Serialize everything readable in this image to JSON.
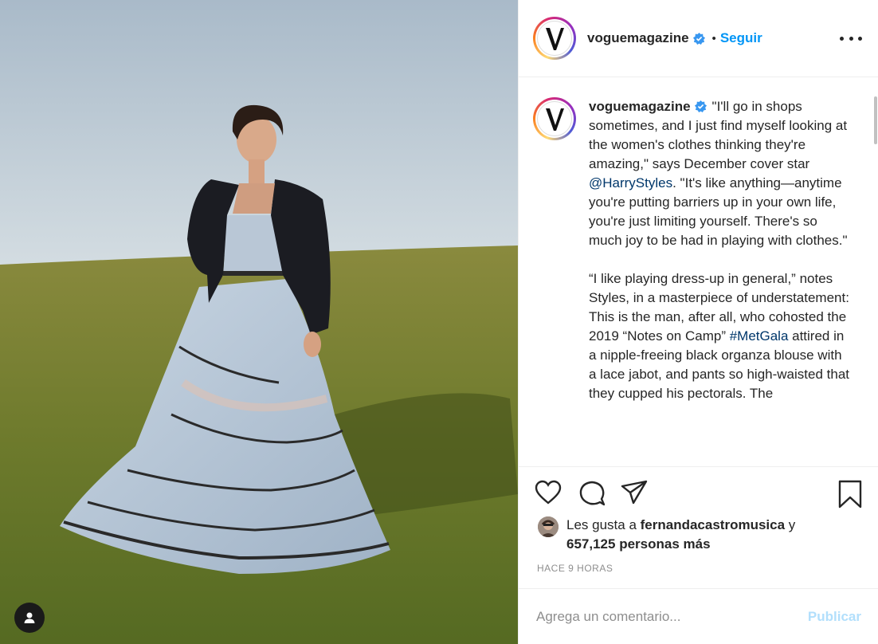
{
  "post": {
    "account": "voguemagazine",
    "follow_label": "Seguir",
    "separator": "•",
    "caption_paragraphs": [
      [
        {
          "type": "text",
          "value": "\"I'll go in shops sometimes, and I just find myself looking at the women's clothes thinking they're amazing,\" says December cover star "
        },
        {
          "type": "mention",
          "value": "@HarryStyles"
        },
        {
          "type": "text",
          "value": ". \"It's like anything—anytime you're putting barriers up in your own life, you're just limiting yourself. There's so much joy to be had in playing with clothes.\""
        }
      ],
      [
        {
          "type": "text",
          "value": "“I like playing dress-up in general,” notes Styles, in a masterpiece of understatement: This is the man, after all, who cohosted the 2019 “Notes on Camp” "
        },
        {
          "type": "mention",
          "value": "#MetGala"
        },
        {
          "type": "text",
          "value": " attired in a nipple-freeing black organza blouse with a lace jabot, and pants so high-waisted that they cupped his pectorals. The"
        }
      ]
    ],
    "likes": {
      "prefix": "Les gusta a",
      "user": "fernandacastromusica",
      "conj": "y",
      "count": "657,125",
      "suffix": "personas más"
    },
    "timestamp": "HACE 9 HORAS",
    "comment_placeholder": "Agrega un comentario...",
    "publish_label": "Publicar"
  },
  "icons": {
    "like": "heart-icon",
    "comment": "comment-icon",
    "share": "paper-plane-icon",
    "save": "bookmark-icon",
    "more": "more-options-icon",
    "verified": "verified-badge-icon",
    "user_tag": "user-tag-icon"
  },
  "colors": {
    "link": "#0095f6",
    "mention": "#00376b",
    "publish_disabled": "#b2dffc",
    "muted": "#8e8e8e"
  }
}
